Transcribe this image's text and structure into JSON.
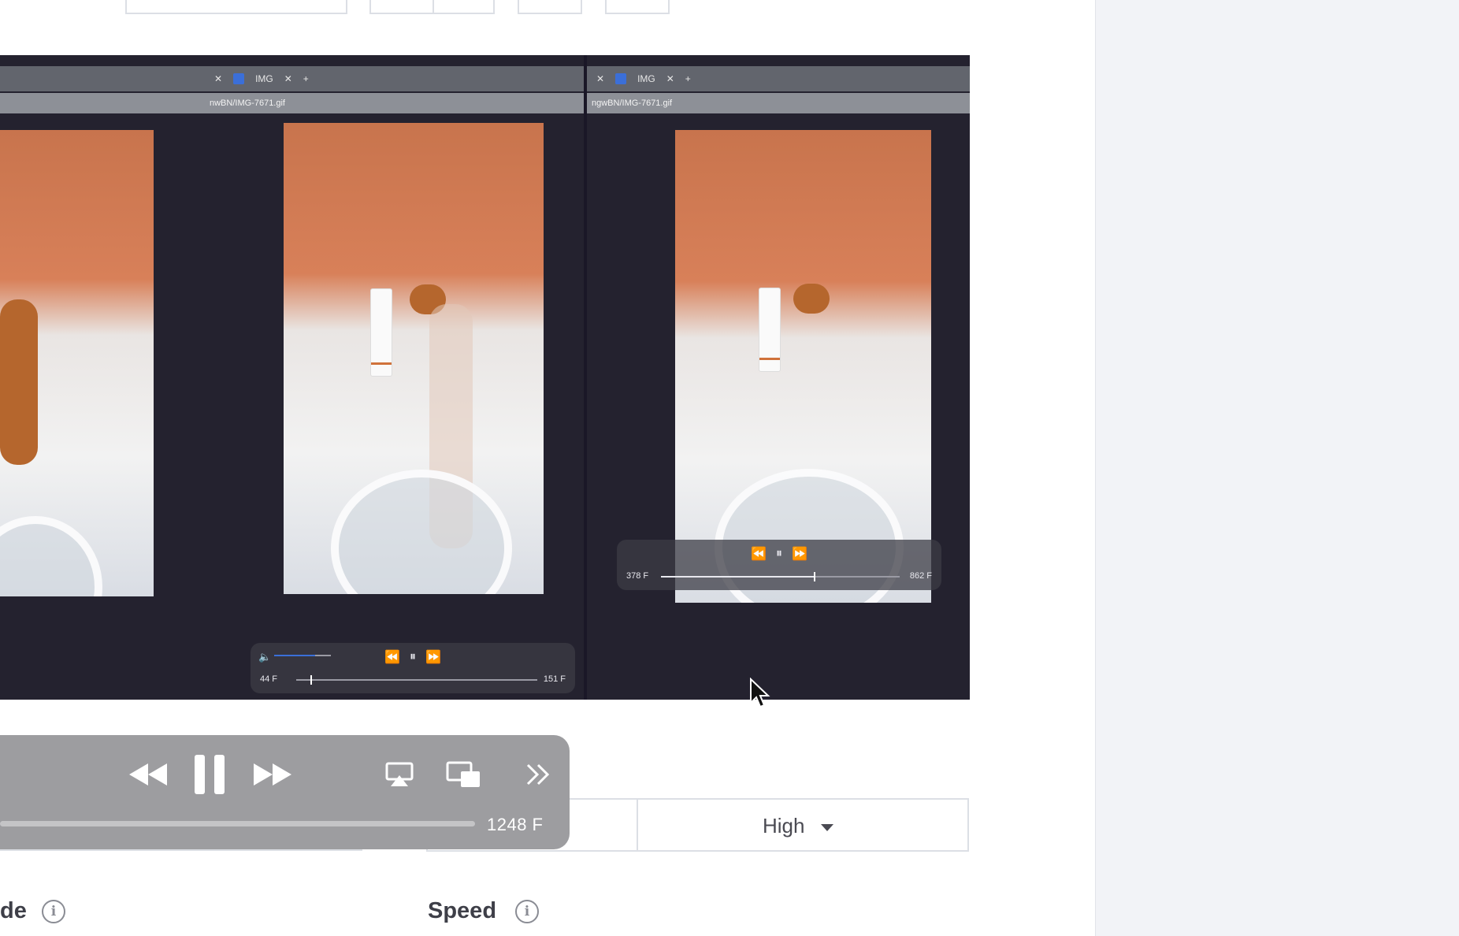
{
  "video_preview": {
    "panels": [
      {
        "tab_label": "IMG",
        "address": ""
      },
      {
        "tab_label": "IMG",
        "address": "nwBN/IMG-7671.gif"
      },
      {
        "tab_label": "IMG",
        "address": "ngwBN/IMG-7671.gif"
      }
    ],
    "inner_player_1": {
      "time_left": "44 F",
      "time_right": "151 F",
      "progress": 0.06,
      "volume": 0.72
    },
    "inner_player_2": {
      "time_left": "378 F",
      "time_right": "862 F",
      "progress": 0.64
    }
  },
  "player_controls": {
    "frame_count": "1248 F",
    "icons": [
      "rewind-icon",
      "pause-icon",
      "fast-forward-icon",
      "airplay-icon",
      "picture-in-picture-icon",
      "more-chevrons-icon"
    ]
  },
  "quality_select": {
    "value": "High"
  },
  "labels": {
    "left_label": "de",
    "speed_label": "Speed"
  },
  "colors": {
    "control_bar": "#9d9da0",
    "border": "#dcdfe5",
    "sidebar": "#f2f3f7",
    "label_text": "#3e3f48",
    "accent_blue": "#3b6fd8"
  }
}
